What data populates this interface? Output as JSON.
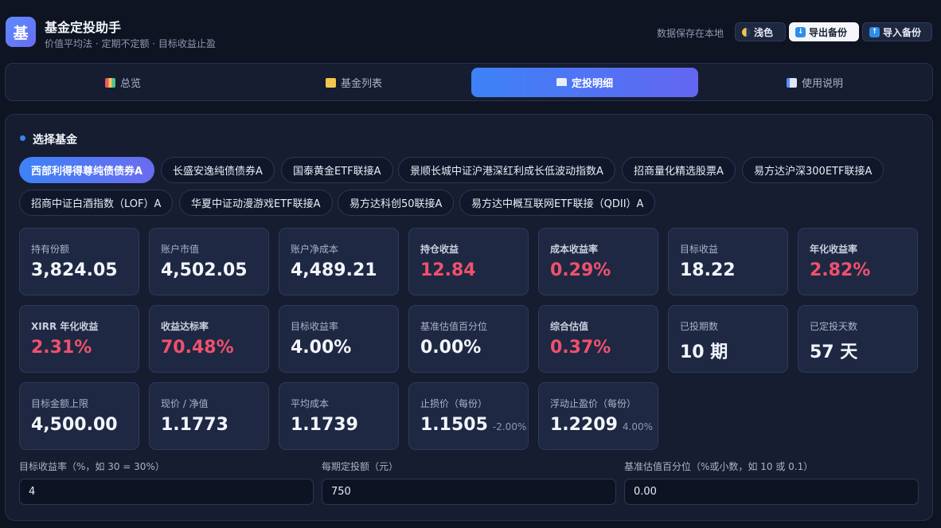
{
  "app": {
    "logo_char": "基",
    "title": "基金定投助手",
    "subtitle": "价值平均法 · 定期不定额 · 目标收益止盈"
  },
  "header": {
    "save_note": "数据保存在本地",
    "theme_label": "浅色",
    "export_label": "导出备份",
    "import_label": "导入备份"
  },
  "tabs": [
    {
      "label": "总览",
      "icon": "chart-icon"
    },
    {
      "label": "基金列表",
      "icon": "folder-icon"
    },
    {
      "label": "定投明细",
      "icon": "trend-icon",
      "active": true
    },
    {
      "label": "使用说明",
      "icon": "book-icon"
    }
  ],
  "section": {
    "title": "选择基金"
  },
  "funds": [
    "西部利得得尊纯债债券A",
    "长盛安逸纯债债券A",
    "国泰黄金ETF联接A",
    "景顺长城中证沪港深红利成长低波动指数A",
    "招商量化精选股票A",
    "易方达沪深300ETF联接A",
    "招商中证白酒指数（LOF）A",
    "华夏中证动漫游戏ETF联接A",
    "易方达科创50联接A",
    "易方达中概互联网ETF联接（QDII）A"
  ],
  "selected_fund": "西部利得得尊纯债债券A",
  "stats": [
    {
      "label": "持有份额",
      "value": "3,824.05"
    },
    {
      "label": "账户市值",
      "value": "4,502.05"
    },
    {
      "label": "账户净成本",
      "value": "4,489.21"
    },
    {
      "label": "持仓收益",
      "value": "12.84"
    },
    {
      "label": "成本收益率",
      "value": "0.29%"
    },
    {
      "label": "目标收益",
      "value": "18.22"
    },
    {
      "label": "年化收益率",
      "value": "2.82%"
    },
    {
      "label": "XIRR 年化收益",
      "value": "2.31%"
    },
    {
      "label": "收益达标率",
      "value": "70.48%"
    },
    {
      "label": "目标收益率",
      "value": "4.00%"
    },
    {
      "label": "基准估值百分位",
      "value": "0.00%"
    },
    {
      "label": "综合估值",
      "value": "0.37%"
    },
    {
      "label": "已投期数",
      "value": "10 期"
    },
    {
      "label": "已定投天数",
      "value": "57 天"
    },
    {
      "label": "目标金额上限",
      "value": "4,500.00"
    },
    {
      "label": "现价 / 净值",
      "value": "1.1773"
    },
    {
      "label": "平均成本",
      "value": "1.1739"
    },
    {
      "label": "止损价（每份）",
      "value": "1.1505",
      "sub": "-2.00%"
    },
    {
      "label": "浮动止盈价（每份）",
      "value": "1.2209",
      "sub": "4.00%"
    }
  ],
  "form": {
    "target_rate": {
      "label": "目标收益率（%，如 30 = 30%）",
      "value": "4"
    },
    "period_amount": {
      "label": "每期定投额（元）",
      "value": "750"
    },
    "benchmark_pct": {
      "label": "基准估值百分位（%或小数，如 10 或 0.1）",
      "value": "0.00"
    }
  },
  "colors": {
    "accent": "#3d82f6",
    "accent2": "#6366f1",
    "positive": "#f0506e",
    "background": "#0f1423"
  }
}
